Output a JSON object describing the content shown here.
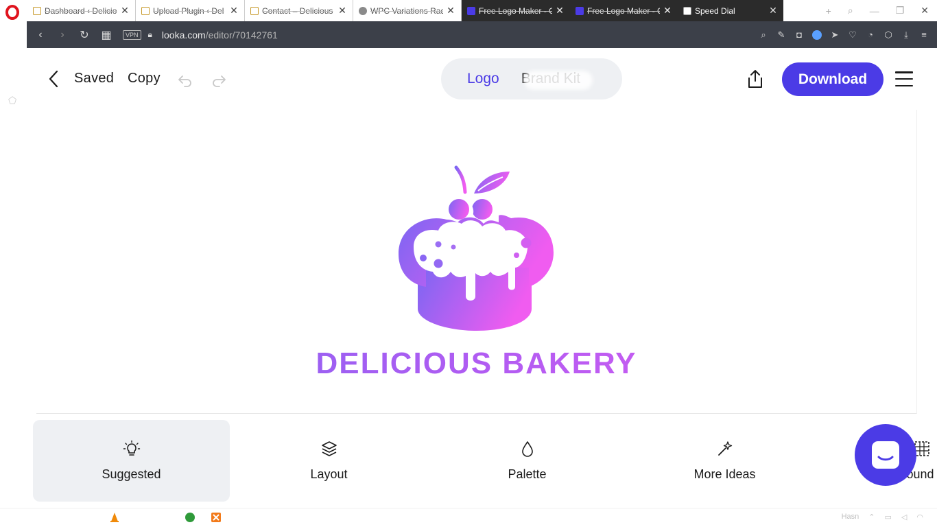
{
  "browser": {
    "tabs": [
      {
        "title": "Dashboard ‹ Delicio",
        "favicon": "db-favicon"
      },
      {
        "title": "Upload Plugin ‹ Del",
        "favicon": "db-favicon"
      },
      {
        "title": "Contact – Delicious",
        "favicon": "db-favicon"
      },
      {
        "title": "WPC Variations Rad",
        "favicon": "wordpress-favicon"
      },
      {
        "title": "Free Logo Maker - C",
        "favicon": "looka-favicon"
      },
      {
        "title": "Free Logo Maker - C",
        "favicon": "looka-favicon"
      },
      {
        "title": "Speed Dial",
        "favicon": "speed-dial-favicon"
      }
    ],
    "vpn_label": "VPN",
    "url_host": "looka.com",
    "url_path": "/editor/70142761"
  },
  "editor": {
    "saved_label": "Saved",
    "copy_label": "Copy",
    "segment": {
      "logo_label": "Logo",
      "brand_label": "Brand Kit"
    },
    "download_label": "Download"
  },
  "canvas": {
    "brand_name": "DELICIOUS BAKERY",
    "gradient_start": "#7b66f3",
    "gradient_end": "#e35bf0"
  },
  "toolbar": {
    "tools": [
      {
        "label": "Suggested",
        "icon": "lightbulb-icon",
        "active": true
      },
      {
        "label": "Layout",
        "icon": "layers-icon",
        "active": false
      },
      {
        "label": "Palette",
        "icon": "droplet-icon",
        "active": false
      },
      {
        "label": "More Ideas",
        "icon": "magic-wand-icon",
        "active": false
      },
      {
        "label": "Background",
        "icon": "grid-icon",
        "active": false
      }
    ]
  },
  "colors": {
    "accent": "#4b3be6",
    "addressbar": "#3c4049"
  },
  "taskbar": {
    "tray_text": "Hasn"
  }
}
